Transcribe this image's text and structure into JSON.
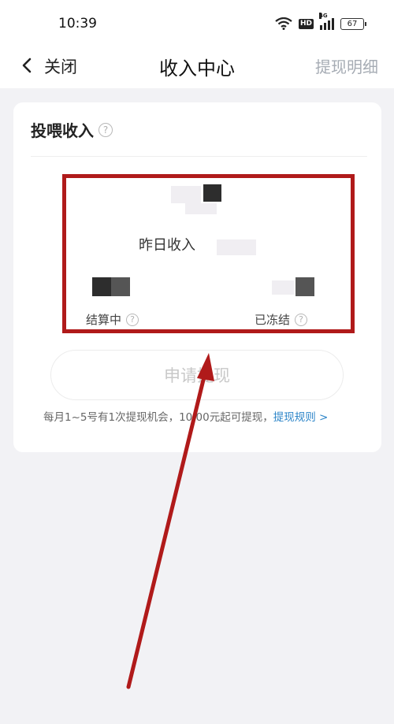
{
  "status_bar": {
    "time": "10:39",
    "hd_label": "HD",
    "network_label": "4G",
    "battery": "67"
  },
  "nav": {
    "back_label": "关闭",
    "title": "收入中心",
    "right_label": "提现明细"
  },
  "income_card": {
    "title": "投喂收入",
    "help_icon": "?",
    "yesterday_label": "昨日收入",
    "settling_label": "结算中",
    "frozen_label": "已冻结",
    "withdraw_button": "申请提现",
    "note_text": "每月1~5号有1次提现机会，10.00元起可提现，",
    "note_link": "提现规则 >"
  },
  "colors": {
    "highlight_box": "#b01a1a",
    "annotation_arrow": "#b01a1a",
    "link": "#2b84c8",
    "nav_right": "#a6acb4"
  }
}
